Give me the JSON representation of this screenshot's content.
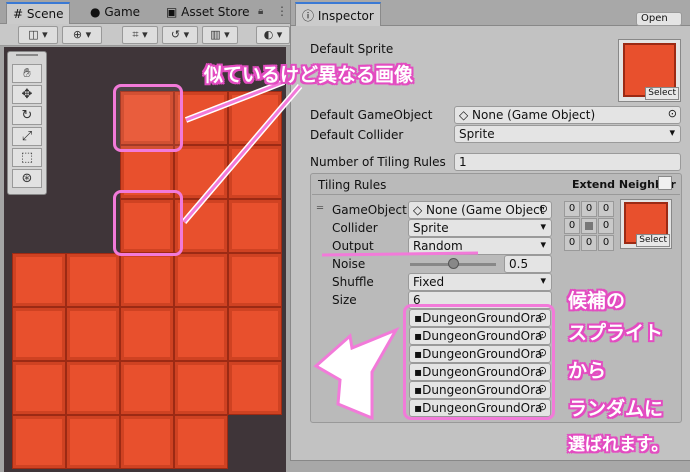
{
  "scene": {
    "tabs": [
      "Scene",
      "Game",
      "Asset Store"
    ],
    "tools": [
      "hand-tool",
      "move-tool",
      "rotate-tool",
      "scale-tool",
      "rect-tool",
      "transform-tool"
    ]
  },
  "inspector": {
    "tab_label": "Inspector",
    "open_button": "Open",
    "default_sprite_label": "Default Sprite",
    "select_label": "Select",
    "default_gameobject_label": "Default GameObject",
    "default_gameobject_value": "None (Game Object)",
    "default_collider_label": "Default Collider",
    "default_collider_value": "Sprite",
    "num_rules_label": "Number of Tiling Rules",
    "num_rules_value": "1",
    "tiling_rules_label": "Tiling Rules",
    "extend_neighbor_label": "Extend Neighbor",
    "rule": {
      "gameobject_label": "GameObject",
      "gameobject_value": "None (Game Object",
      "collider_label": "Collider",
      "collider_value": "Sprite",
      "output_label": "Output",
      "output_value": "Random",
      "noise_label": "Noise",
      "noise_value": "0.5",
      "shuffle_label": "Shuffle",
      "shuffle_value": "Fixed",
      "size_label": "Size",
      "size_value": "6",
      "neighbor_grid": [
        "0",
        "0",
        "0",
        "0",
        "",
        "0",
        "0",
        "0",
        "0"
      ],
      "sprites": [
        "DungeonGroundOra",
        "DungeonGroundOra",
        "DungeonGroundOra",
        "DungeonGroundOra",
        "DungeonGroundOra",
        "DungeonGroundOra"
      ]
    }
  },
  "annotations": {
    "similar_but_different": "似ているけど異なる画像",
    "candidate_line1": "候補の",
    "candidate_line2": "スプライト",
    "candidate_line3": "から",
    "candidate_line4": "ランダムに",
    "candidate_line5": "選ばれます。",
    "accent_color": "#e34cc1"
  }
}
